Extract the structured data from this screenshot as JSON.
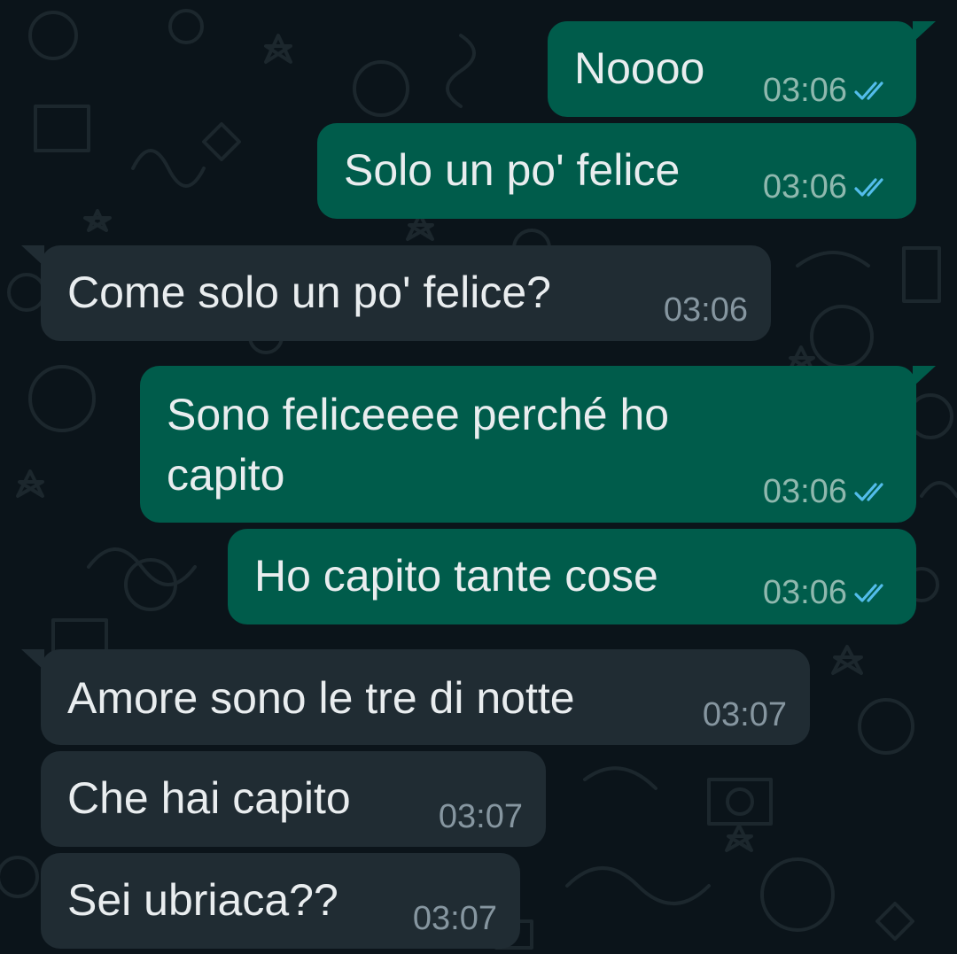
{
  "colors": {
    "background": "#0b141a",
    "outgoing_bubble": "#005c4b",
    "incoming_bubble": "#202c33",
    "text": "#e9edef",
    "outgoing_time": "#8fb8ae",
    "incoming_time": "#8696a0",
    "read_ticks": "#53bdeb"
  },
  "messages": [
    {
      "direction": "outgoing",
      "text": "Noooo",
      "time": "03:06",
      "status_icon": "double-check-read-icon"
    },
    {
      "direction": "outgoing",
      "text": "Solo un po' felice",
      "time": "03:06",
      "status_icon": "double-check-read-icon"
    },
    {
      "direction": "incoming",
      "text": "Come solo un po' felice?",
      "time": "03:06"
    },
    {
      "direction": "outgoing",
      "text_lines": [
        "Sono feliceeee perché ho",
        "capito"
      ],
      "time": "03:06",
      "status_icon": "double-check-read-icon"
    },
    {
      "direction": "outgoing",
      "text": "Ho capito tante cose",
      "time": "03:06",
      "status_icon": "double-check-read-icon"
    },
    {
      "direction": "incoming",
      "text": "Amore sono le tre di notte",
      "time": "03:07"
    },
    {
      "direction": "incoming",
      "text": "Che hai capito",
      "time": "03:07"
    },
    {
      "direction": "incoming",
      "text": "Sei ubriaca??",
      "time": "03:07"
    }
  ]
}
